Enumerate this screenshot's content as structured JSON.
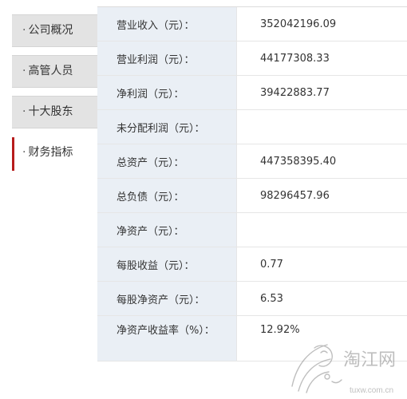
{
  "sidebar": {
    "items": [
      {
        "dot": "·",
        "label": "公司概况",
        "active": false
      },
      {
        "dot": "·",
        "label": "高管人员",
        "active": false
      },
      {
        "dot": "·",
        "label": "十大股东",
        "active": false
      },
      {
        "dot": "·",
        "label": "财务指标",
        "active": true
      }
    ]
  },
  "financials": {
    "rows": [
      {
        "label": "营业收入（元）：",
        "value": "352042196.09"
      },
      {
        "label": "营业利润（元）：",
        "value": "44177308.33"
      },
      {
        "label": "净利润（元）：",
        "value": "39422883.77"
      },
      {
        "label": "未分配利润（元）：",
        "value": ""
      },
      {
        "label": "总资产（元）：",
        "value": "447358395.40"
      },
      {
        "label": "总负债（元）：",
        "value": "98296457.96"
      },
      {
        "label": "净资产（元）：",
        "value": ""
      },
      {
        "label": "每股收益（元）：",
        "value": "0.77"
      },
      {
        "label": "每股净资产（元）：",
        "value": "6.53"
      },
      {
        "label": "净资产收益率（%）：",
        "value": "12.92%"
      }
    ]
  },
  "watermark": {
    "text": "淘江网",
    "url_text": "tuxw.com.cn",
    "color": "#8a8a8a"
  },
  "colors": {
    "accent": "#b71c1c",
    "label_bg": "#eaeff5",
    "tab_bg": "#e3e3e3"
  }
}
